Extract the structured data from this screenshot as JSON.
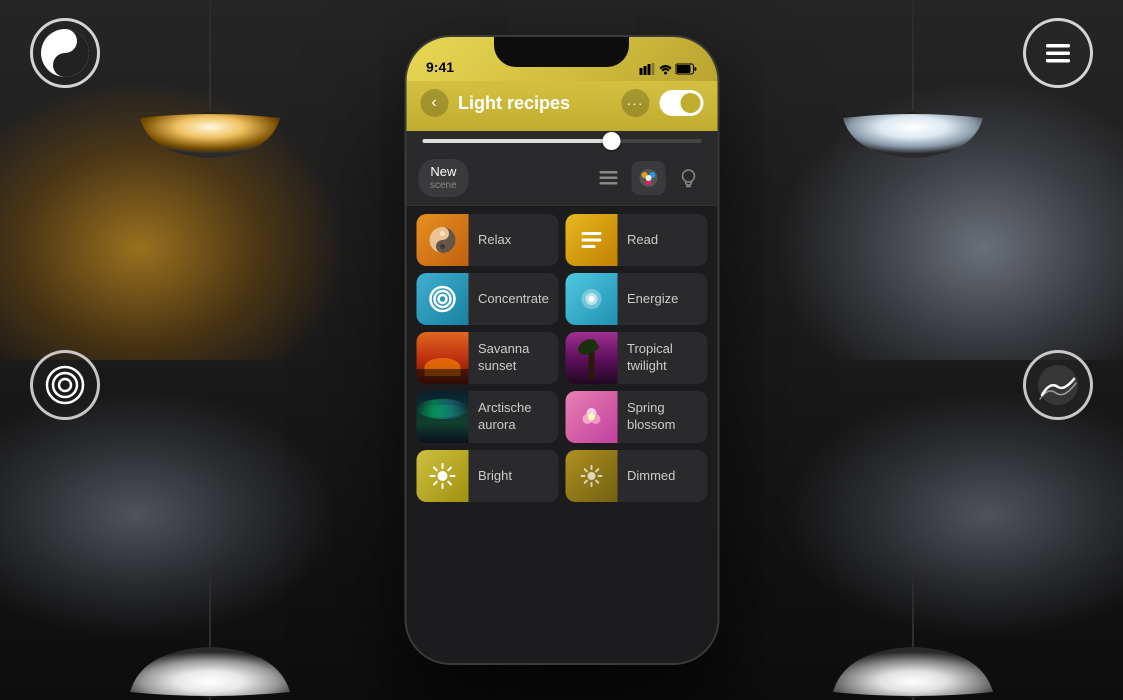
{
  "scene": {
    "background_color": "#1a1a1a"
  },
  "icons": {
    "top_left": "yin-yang",
    "top_right": "menu",
    "bottom_left": "target",
    "bottom_right": "mountain"
  },
  "phone": {
    "status_bar": {
      "time": "9:41",
      "signal": "▲▲▲",
      "wifi": "WiFi",
      "battery": "🔋"
    },
    "header": {
      "back_label": "‹",
      "title": "Light recipes",
      "dots_label": "···",
      "toggle_on": true
    },
    "toolbar": {
      "new_scene_label": "New",
      "new_scene_sublabel": "scene",
      "list_icon": "≡",
      "palette_icon": "🎨",
      "bulb_icon": "💡"
    },
    "recipes": [
      {
        "id": "relax",
        "name": "Relax",
        "icon_type": "yin"
      },
      {
        "id": "read",
        "name": "Read",
        "icon_type": "lines"
      },
      {
        "id": "concentrate",
        "name": "Concentrate",
        "icon_type": "spiral"
      },
      {
        "id": "energize",
        "name": "Energize",
        "icon_type": "drop"
      },
      {
        "id": "savanna",
        "name": "Savanna sunset",
        "icon_type": "sunset"
      },
      {
        "id": "tropical",
        "name": "Tropical twilight",
        "icon_type": "palm"
      },
      {
        "id": "arctic",
        "name": "Arctische aurora",
        "icon_type": "aurora"
      },
      {
        "id": "spring",
        "name": "Spring blossom",
        "icon_type": "flower"
      },
      {
        "id": "bright",
        "name": "Bright",
        "icon_type": "sun"
      },
      {
        "id": "dimmed",
        "name": "Dimmed",
        "icon_type": "sun-dim"
      }
    ]
  }
}
